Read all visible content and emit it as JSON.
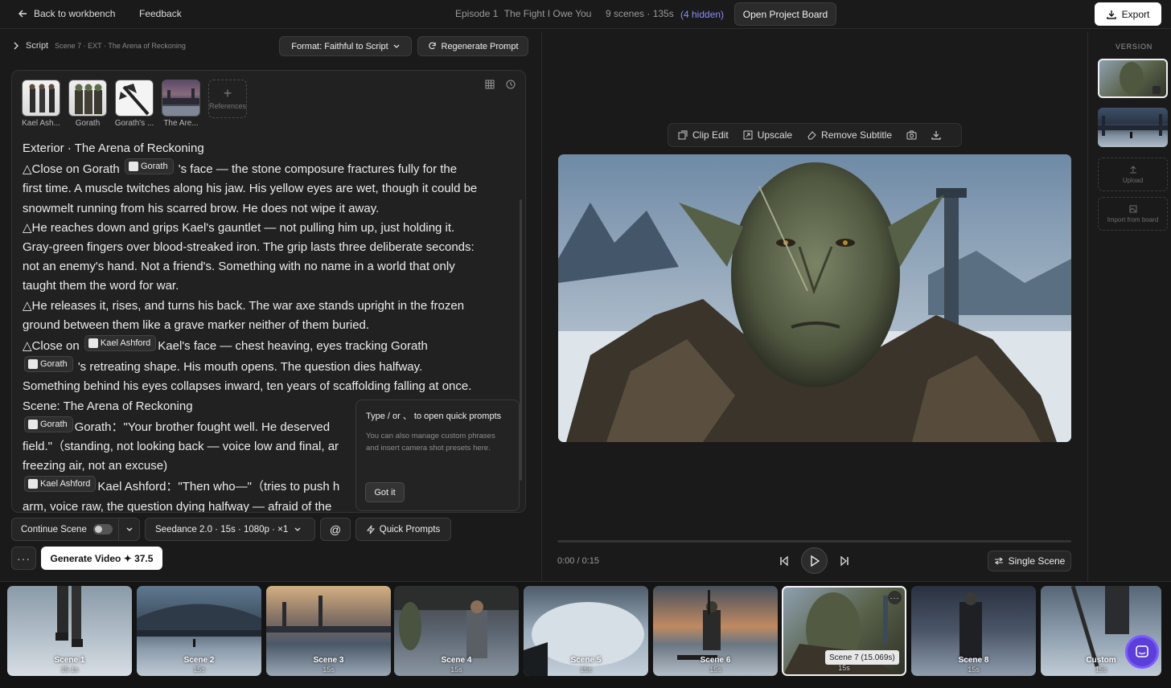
{
  "topbar": {
    "back_label": "Back to workbench",
    "feedback_label": "Feedback",
    "episode_label": "Episode 1",
    "episode_name": "The Fight I Owe You",
    "scene_stats": "9 scenes · 135s",
    "hidden_label": "(4 hidden)",
    "open_board_label": "Open Project Board",
    "export_label": "Export"
  },
  "script_header": {
    "label": "Script",
    "sublabel": "Scene 7 · EXT · The Arena of Reckoning",
    "format_label": "Format: Faithful to Script",
    "regenerate_label": "Regenerate Prompt"
  },
  "references": [
    {
      "label": "Kael Ash..."
    },
    {
      "label": "Gorath"
    },
    {
      "label": "Gorath's ..."
    },
    {
      "label": "The Are..."
    }
  ],
  "references_add_label": "References",
  "script": {
    "l1": "Exterior · The Arena of Reckoning",
    "l2a": "△Close on Gorath",
    "tag_gorath": "Gorath",
    "tag_kael": "Kael Ashford",
    "l2b": "'s face — the stone composure fractures fully for the",
    "l3": "first time. A muscle twitches along his jaw. His yellow eyes are wet, though it could be",
    "l4": "snowmelt running from his scarred brow. He does not wipe it away.",
    "l5": "△He reaches down and grips Kael's gauntlet — not pulling him up, just holding it.",
    "l6": "Gray-green fingers over blood-streaked iron. The grip lasts three deliberate seconds:",
    "l7": "not an enemy's hand. Not a friend's. Something with no name in a world that only",
    "l8": "taught them the word for war.",
    "l9": "△He releases it, rises, and turns his back. The war axe stands upright in the frozen",
    "l10": "ground between them like a grave marker neither of them buried.",
    "l11a": "△Close on",
    "l11b": "Kael's face — chest heaving, eyes tracking Gorath",
    "l12b": "'s retreating shape. His mouth opens. The question dies halfway.",
    "l13": "Something behind his eyes collapses inward, ten years of scaffolding falling at once.",
    "l14": "Scene: The Arena of Reckoning",
    "l15b": "Gorath：\"Your brother fought well. He deserved",
    "l16": "field.\"（standing, not looking back — voice low and final, ar",
    "l17": "freezing air, not an excuse)",
    "l18b": "Kael Ashford：\"Then who—\"（tries to push h",
    "l19": "arm, voice raw, the question dying halfway — afraid of the"
  },
  "tip": {
    "title": "Type / or 、 to open quick prompts",
    "body": "You can also manage custom phrases and insert camera shot presets here.",
    "button": "Got it"
  },
  "controls": {
    "continue_scene": "Continue Scene",
    "model": "Seedance 2.0 · 15s · 1080p · ×1",
    "at_symbol": "@",
    "quick_prompts": "Quick Prompts",
    "more": "···",
    "generate": "Generate Video ✦ 37.5"
  },
  "preview_toolbar": {
    "clip_edit": "Clip Edit",
    "upscale": "Upscale",
    "remove_subtitle": "Remove Subtitle"
  },
  "player": {
    "time": "0:00 / 0:15",
    "single_scene": "Single Scene"
  },
  "version": {
    "title": "VERSION",
    "upload": "Upload",
    "import": "Import from board"
  },
  "scenes": [
    {
      "name": "Scene 1",
      "dur": "15.1s"
    },
    {
      "name": "Scene 2",
      "dur": "15s"
    },
    {
      "name": "Scene 3",
      "dur": "15s"
    },
    {
      "name": "Scene 4",
      "dur": "15s"
    },
    {
      "name": "Scene 5",
      "dur": "15s"
    },
    {
      "name": "Scene 6",
      "dur": "15s"
    },
    {
      "name": "Scene 7",
      "dur": "15s",
      "tooltip": "Scene 7 (15.069s)"
    },
    {
      "name": "Scene 8",
      "dur": "15s"
    },
    {
      "name": "Custom",
      "dur": "15s"
    }
  ],
  "colors": {
    "accent_link": "#8a8cff",
    "chat_button": "#5b3fd8"
  }
}
